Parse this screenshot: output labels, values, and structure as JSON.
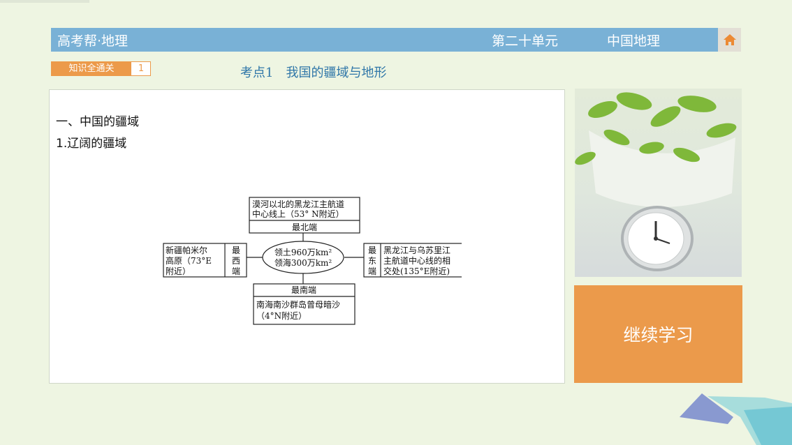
{
  "header": {
    "brand": "高考帮·地理",
    "unit": "第二十单元",
    "subject": "中国地理",
    "home_icon": "home-icon"
  },
  "tag": {
    "label": "知识全通关",
    "number": "1"
  },
  "section_title": "考点1　我国的疆域与地形",
  "content": {
    "heading1": "一、中国的疆域",
    "heading2": "1.辽阔的疆域"
  },
  "diagram": {
    "center": {
      "line1": "领土960万km²",
      "line2": "领海300万km²"
    },
    "north": {
      "desc1": "漠河以北的黑龙江主航道",
      "desc2": "中心线上（53° N附近）",
      "label": "最北端"
    },
    "west": {
      "desc1": "新疆帕米尔",
      "desc2": "高原（73°E",
      "desc3": "附近）",
      "label1": "最",
      "label2": "西",
      "label3": "端"
    },
    "east": {
      "label1": "最",
      "label2": "东",
      "label3": "端",
      "desc1": "黑龙江与乌苏里江",
      "desc2": "主航道中心线的相",
      "desc3": "交处(135°E附近)"
    },
    "south": {
      "label": "最南端",
      "desc1": "南海南沙群岛曾母暗沙",
      "desc2": "（4°N附近）"
    }
  },
  "sidebar": {
    "continue_label": "继续学习"
  },
  "colors": {
    "header_bar": "#79b1d6",
    "accent_orange": "#eb9a4b",
    "title_blue": "#2f76a8"
  }
}
